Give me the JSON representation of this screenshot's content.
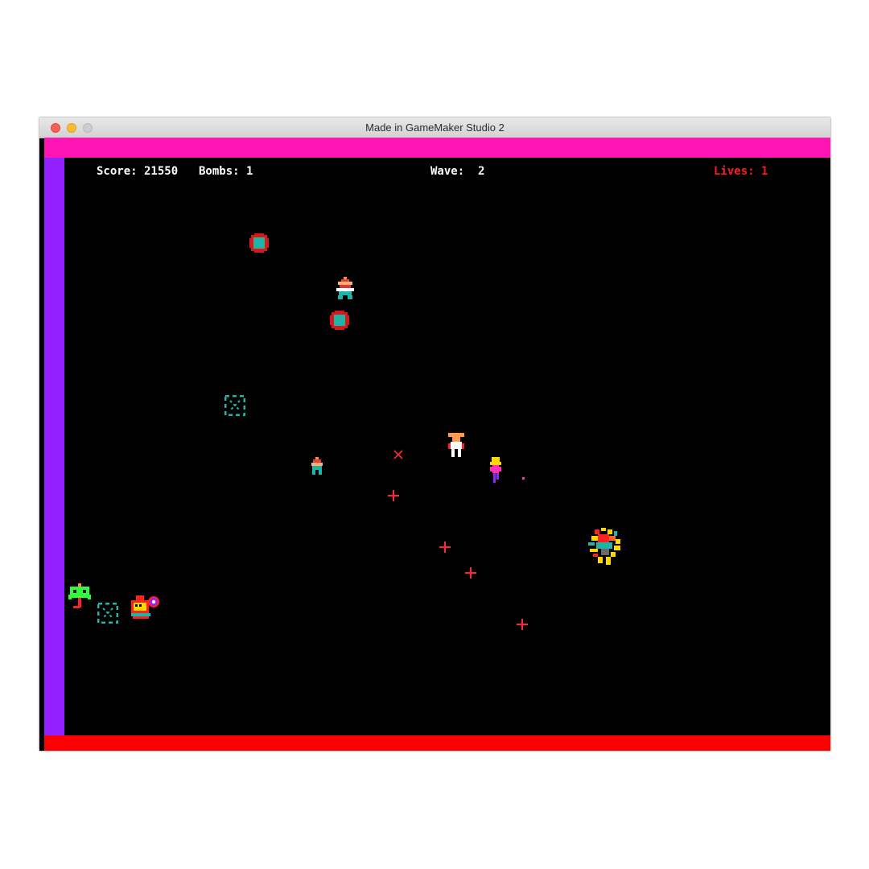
{
  "window": {
    "title": "Made in GameMaker Studio 2"
  },
  "hud": {
    "score": "Score: 21550",
    "bombs": "Bombs: 1",
    "wave": "Wave:  2",
    "lives": "Lives: 1"
  },
  "colors": {
    "wall_top": "#ff14b4",
    "wall_left": "#9320ff",
    "wall_bottom": "#ff0000",
    "playfield": "#000000",
    "hud_text": "#ffffff",
    "lives_text": "#ff1a1a"
  },
  "entities": {
    "player": "player-sprite",
    "enemies": [
      "electrode-enemy",
      "electrode-enemy",
      "hulk-enemy",
      "grunt-enemy",
      "brain-enemy",
      "spheroid-enemy",
      "enforcer-spark",
      "explosion-burst"
    ],
    "humans": [
      "daddy-human",
      "mommy-human"
    ],
    "projectiles": [
      "cross-shot",
      "cross-shot",
      "cross-shot",
      "cross-shot",
      "x-spark"
    ]
  }
}
